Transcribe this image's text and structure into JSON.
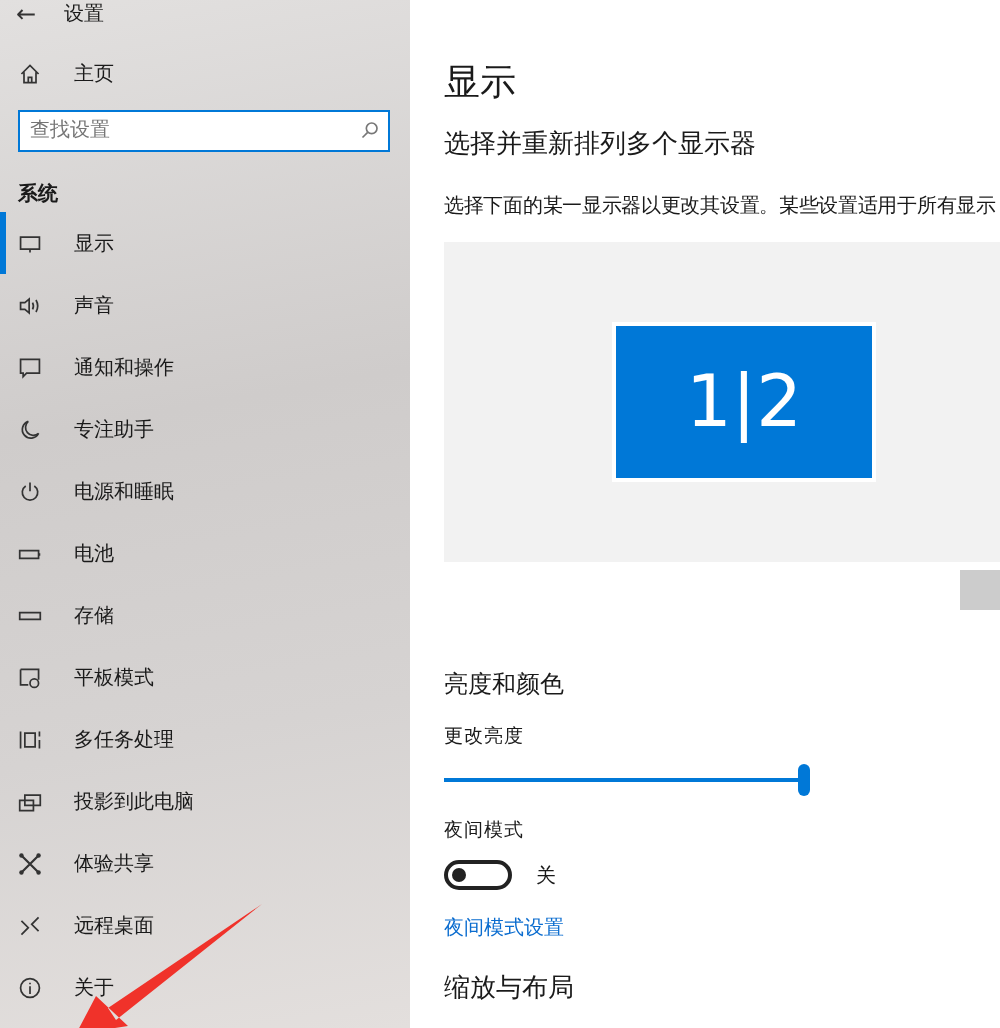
{
  "window": {
    "back": "←",
    "title": "设置"
  },
  "sidebar": {
    "home": "主页",
    "search": {
      "placeholder": "查找设置"
    },
    "section": "系统",
    "items": [
      {
        "label": "显示",
        "selected": true
      },
      {
        "label": "声音",
        "selected": false
      },
      {
        "label": "通知和操作",
        "selected": false
      },
      {
        "label": "专注助手",
        "selected": false
      },
      {
        "label": "电源和睡眠",
        "selected": false
      },
      {
        "label": "电池",
        "selected": false
      },
      {
        "label": "存储",
        "selected": false
      },
      {
        "label": "平板模式",
        "selected": false
      },
      {
        "label": "多任务处理",
        "selected": false
      },
      {
        "label": "投影到此电脑",
        "selected": false
      },
      {
        "label": "体验共享",
        "selected": false
      },
      {
        "label": "远程桌面",
        "selected": false
      },
      {
        "label": "关于",
        "selected": false
      }
    ]
  },
  "content": {
    "title": "显示",
    "subtitle": "选择并重新排列多个显示器",
    "description": "选择下面的某一显示器以更改其设置。某些设置适用于所有显示",
    "monitor_label": "1|2",
    "brightness_heading": "亮度和颜色",
    "brightness_label": "更改亮度",
    "brightness": {
      "level": 1
    },
    "night_label": "夜间模式",
    "night_toggle": {
      "on": false,
      "state_text": "关"
    },
    "night_link": "夜间模式设置",
    "scale_heading": "缩放与布局"
  },
  "annotation": {
    "kind": "arrow"
  }
}
